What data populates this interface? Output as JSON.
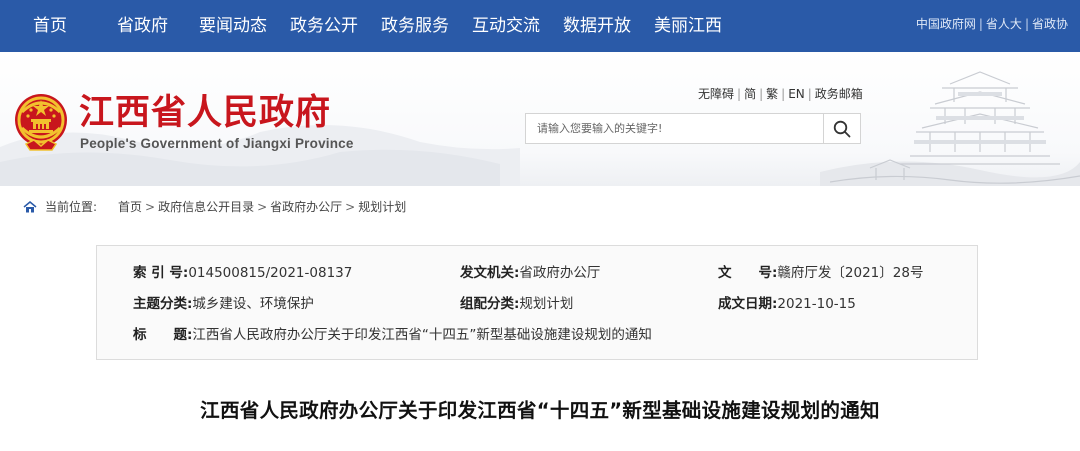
{
  "topnav": {
    "items": [
      "首页",
      "省政府",
      "要闻动态",
      "政务公开",
      "政务服务",
      "互动交流",
      "数据开放",
      "美丽江西"
    ],
    "links": [
      "中国政府网",
      "省人大",
      "省政协"
    ]
  },
  "header": {
    "title": "江西省人民政府",
    "subtitle": "People's Government of Jiangxi Province",
    "util_links": [
      "无障碍",
      "简",
      "繁",
      "EN",
      "政务邮箱"
    ],
    "search": {
      "placeholder": "请输入您要输入的关键字!"
    }
  },
  "breadcrumb": {
    "label": "当前位置:",
    "path": [
      "首页",
      "政府信息公开目录",
      "省政府办公厅",
      "规划计划"
    ]
  },
  "info": {
    "index_label": "索 引 号:",
    "index_value": "014500815/2021-08137",
    "issuer_label": "发文机关:",
    "issuer_value": "省政府办公厅",
    "docno_label": "文　　号:",
    "docno_value": "赣府厅发〔2021〕28号",
    "topic_label": "主题分类:",
    "topic_value": "城乡建设、环境保护",
    "category_label": "组配分类:",
    "category_value": "规划计划",
    "date_label": "成文日期:",
    "date_value": "2021-10-15",
    "title_label": "标　　题:",
    "title_value": "江西省人民政府办公厅关于印发江西省“十四五”新型基础设施建设规划的通知"
  },
  "article": {
    "title": "江西省人民政府办公厅关于印发江西省“十四五”新型基础设施建设规划的通知"
  },
  "colors": {
    "nav_bg": "#2a5aa8",
    "title_red": "#c8161d",
    "emblem_gold": "#f2c12e"
  },
  "icons": {
    "search": "search-icon",
    "home": "home-icon"
  }
}
